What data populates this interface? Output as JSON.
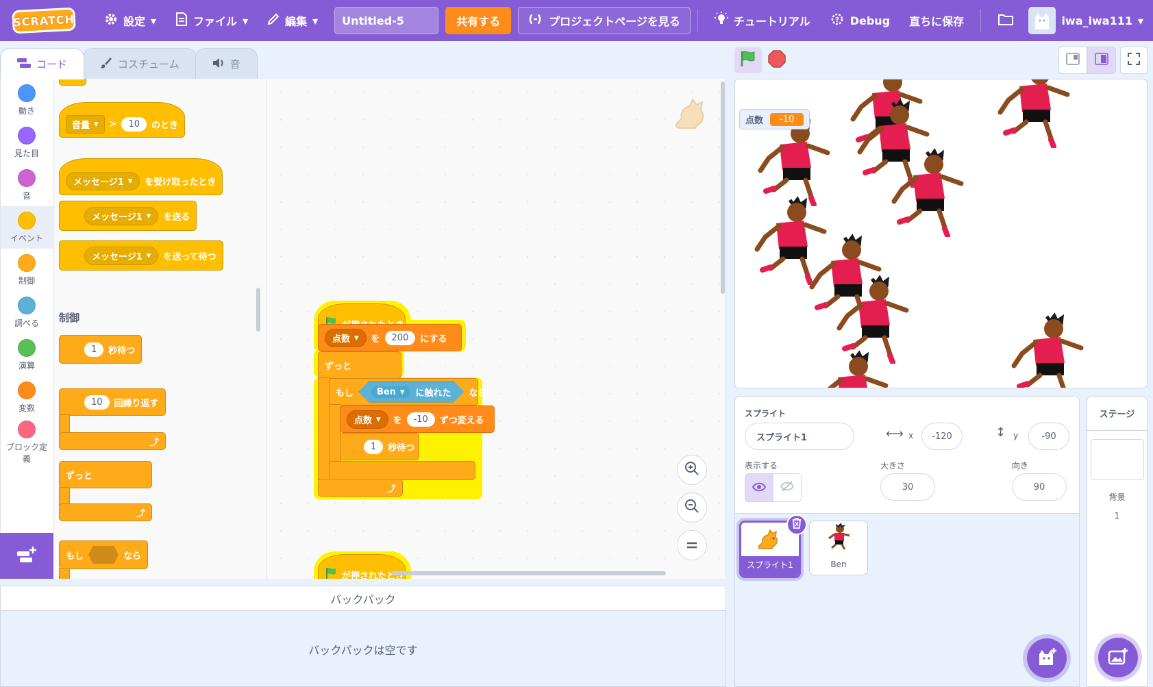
{
  "menu": {
    "logo": "SCRATCH",
    "settings": "設定",
    "file": "ファイル",
    "edit": "編集",
    "project_title": "Untitled-5",
    "share": "共有する",
    "see_project_page": "プロジェクトページを見る",
    "tutorials": "チュートリアル",
    "debug": "Debug",
    "save_now": "直ちに保存",
    "username": "iwa_iwa111"
  },
  "tabs": [
    {
      "label": "コード"
    },
    {
      "label": "コスチューム"
    },
    {
      "label": "音"
    }
  ],
  "categories": [
    {
      "label": "動き",
      "color": "#4c97ff"
    },
    {
      "label": "見た目",
      "color": "#9966ff"
    },
    {
      "label": "音",
      "color": "#cf63cf"
    },
    {
      "label": "イベント",
      "color": "#ffbf00"
    },
    {
      "label": "制御",
      "color": "#ffab19"
    },
    {
      "label": "調べる",
      "color": "#5cb1d6"
    },
    {
      "label": "演算",
      "color": "#59c059"
    },
    {
      "label": "変数",
      "color": "#ff8c1a"
    },
    {
      "label": "ブロック定義",
      "color": "#ff6680"
    }
  ],
  "palette": {
    "events": {
      "loudness_dd": "音量",
      "gt": ">",
      "loudness_value": "10",
      "loudness_suffix": "のとき",
      "receive_dd": "メッセージ1",
      "receive_suffix": "を受け取ったとき",
      "broadcast_dd": "メッセージ1",
      "broadcast_suffix": "を送る",
      "broadcast_wait_dd": "メッセージ1",
      "broadcast_wait_suffix": "を送って待つ"
    },
    "control_heading": "制御",
    "control": {
      "wait_value": "1",
      "wait_suffix": "秒待つ",
      "repeat_value": "10",
      "repeat_suffix": "回繰り返す",
      "forever": "ずっと",
      "if_prefix": "もし",
      "if_suffix": "なら"
    }
  },
  "script": {
    "hat": "が押されたとき",
    "set_var": "点数",
    "set_to": "を",
    "set_value": "200",
    "set_suffix": "にする",
    "forever": "ずっと",
    "if_prefix": "もし",
    "touching_target": "Ben",
    "touching_suffix": "に触れた",
    "if_suffix": "なら",
    "change_var": "点数",
    "change_by": "を",
    "change_value": "-10",
    "change_suffix": "ずつ変える",
    "wait_value": "1",
    "wait_suffix": "秒待つ",
    "hat2": "が押されたとき"
  },
  "backpack": {
    "title": "バックパック",
    "empty": "バックパックは空です"
  },
  "stage": {
    "monitor_label": "点数",
    "monitor_value": "-10"
  },
  "sprite_info": {
    "sprite_label": "スプライト",
    "sprite_name": "スプライト1",
    "x_label": "x",
    "x_value": "-120",
    "y_label": "y",
    "y_value": "-90",
    "show_label": "表示する",
    "size_label": "大きさ",
    "size_value": "30",
    "direction_label": "向き",
    "direction_value": "90"
  },
  "sprites": [
    {
      "name": "スプライト1",
      "selected": true
    },
    {
      "name": "Ben",
      "selected": false
    }
  ],
  "stage_pane": {
    "title": "ステージ",
    "backdrop_label": "背景",
    "backdrop_count": "1"
  },
  "colors": {
    "menu_bar": "#855cd6",
    "share": "#ff8c1a",
    "events": "#ffbf00",
    "control": "#ffab19",
    "variables": "#ff8c1a",
    "sensing": "#5cb1d6",
    "highlight": "#fff200"
  },
  "icons": [
    "gear-icon",
    "file-icon",
    "pencil-icon",
    "see-project-icon",
    "lightbulb-icon",
    "debug-icon",
    "folder-icon",
    "green-flag-icon",
    "stop-icon",
    "small-stage-icon",
    "large-stage-icon",
    "fullscreen-icon",
    "zoom-in-icon",
    "zoom-out-icon",
    "zoom-reset-icon",
    "eye-icon",
    "eye-slash-icon",
    "trash-icon",
    "add-sprite-icon",
    "add-backdrop-icon",
    "add-extension-icon"
  ]
}
